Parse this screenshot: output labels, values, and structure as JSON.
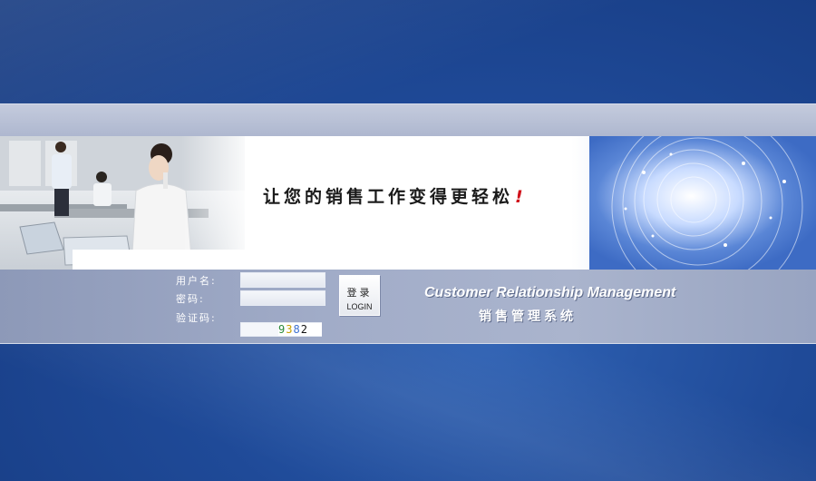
{
  "banner": {
    "slogan": "让您的销售工作变得更轻松",
    "slogan_mark": "!"
  },
  "login": {
    "username_label": "用户名:",
    "password_label": "密码:",
    "captcha_label": "验证码:",
    "username_value": "",
    "password_value": "",
    "captcha_input_value": "",
    "captcha_digits": [
      "9",
      "3",
      "8",
      "2"
    ],
    "captcha_colors": [
      "#2a8a3a",
      "#c8a000",
      "#3c6fd0",
      "#111111"
    ],
    "button_label_cn": "登录",
    "button_label_en": "LOGIN"
  },
  "branding": {
    "title_en": "Customer Relationship Management",
    "title_cn": "销售管理系统"
  }
}
